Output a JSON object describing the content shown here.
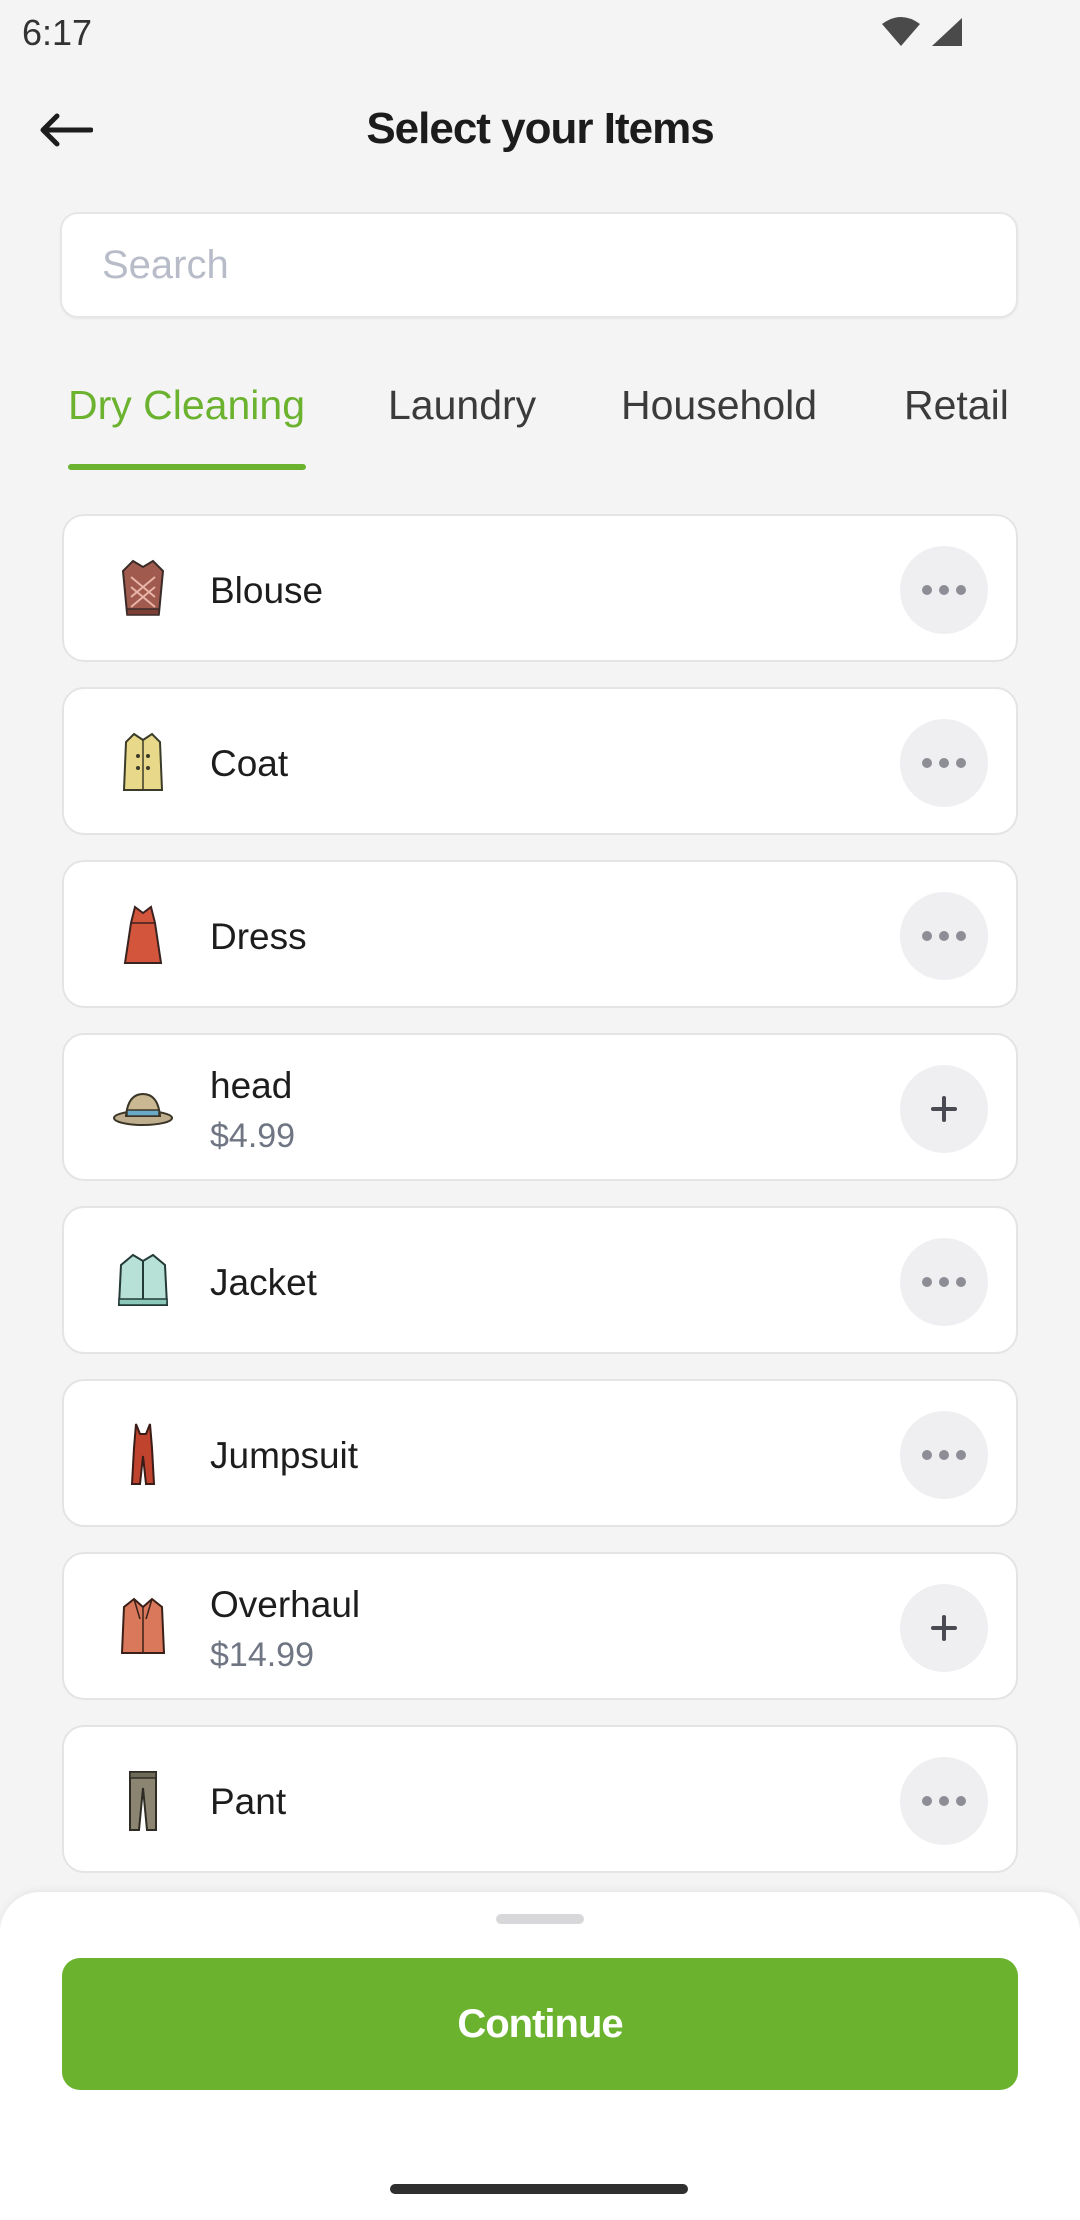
{
  "status_bar": {
    "time": "6:17",
    "icons": [
      "wifi-icon",
      "signal-icon"
    ]
  },
  "header": {
    "title": "Select your Items",
    "back_icon": "arrow-left-icon"
  },
  "search": {
    "placeholder": "Search",
    "value": ""
  },
  "tabs": [
    {
      "label": "Dry Cleaning",
      "active": true
    },
    {
      "label": "Laundry",
      "active": false
    },
    {
      "label": "Household",
      "active": false
    },
    {
      "label": "Retail",
      "active": false
    }
  ],
  "items": [
    {
      "name": "Blouse",
      "price": "",
      "icon": "blouse-icon",
      "action": "more"
    },
    {
      "name": "Coat",
      "price": "",
      "icon": "coat-icon",
      "action": "more"
    },
    {
      "name": "Dress",
      "price": "",
      "icon": "dress-icon",
      "action": "more"
    },
    {
      "name": "head",
      "price": "$4.99",
      "icon": "hat-icon",
      "action": "add"
    },
    {
      "name": "Jacket",
      "price": "",
      "icon": "jacket-icon",
      "action": "more"
    },
    {
      "name": "Jumpsuit",
      "price": "",
      "icon": "jumpsuit-icon",
      "action": "more"
    },
    {
      "name": "Overhaul",
      "price": "$14.99",
      "icon": "overcoat-icon",
      "action": "add"
    },
    {
      "name": "Pant",
      "price": "",
      "icon": "pant-icon",
      "action": "more"
    }
  ],
  "footer": {
    "continue_label": "Continue"
  },
  "colors": {
    "accent": "#6bb22f",
    "background": "#f4f4f5",
    "card": "#ffffff",
    "action_bg": "#efeff2"
  }
}
